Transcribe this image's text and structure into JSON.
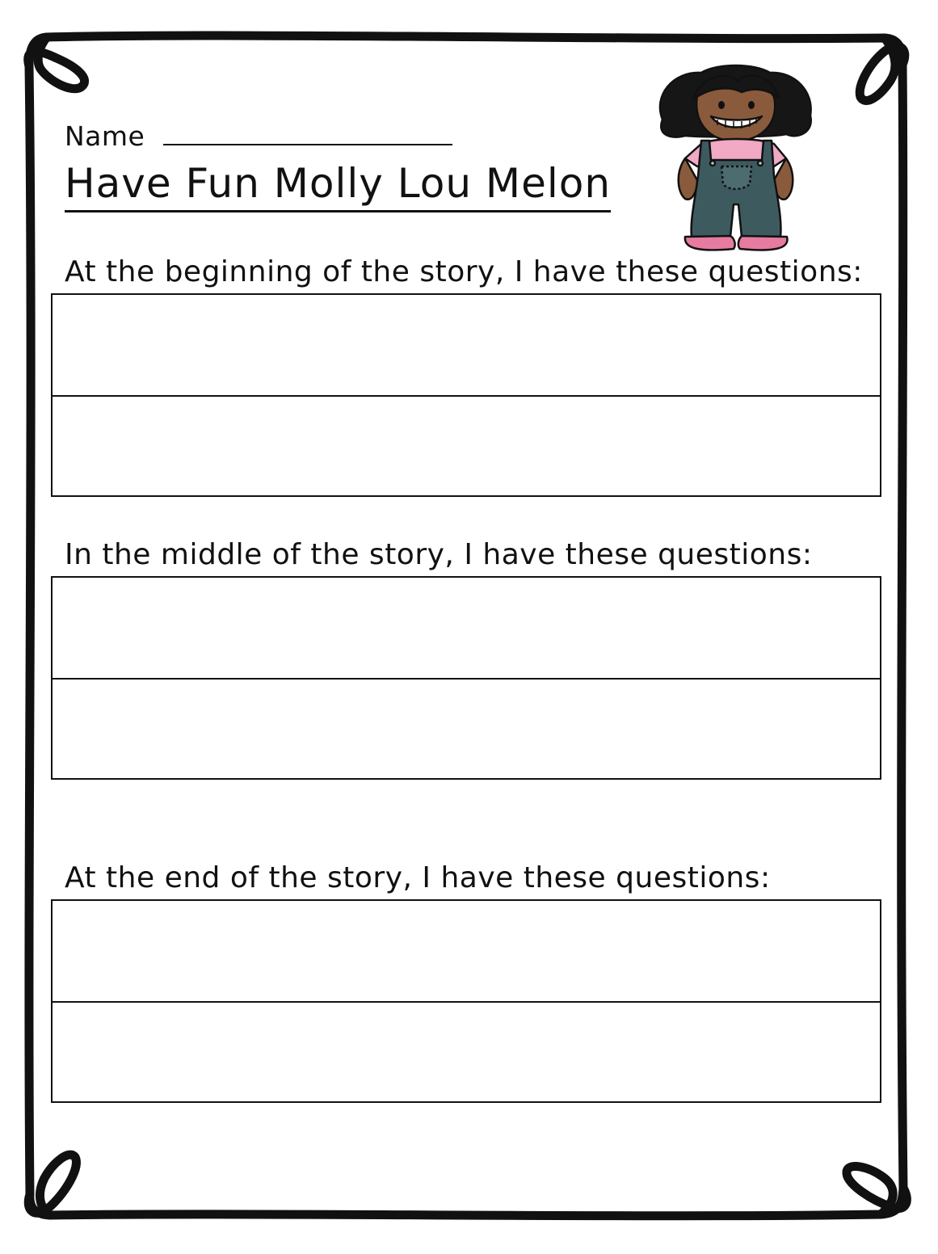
{
  "worksheet": {
    "name_label": "Name",
    "title": "Have Fun Molly Lou Melon",
    "sections": [
      {
        "prompt": "At the beginning of the story, I have these questions:"
      },
      {
        "prompt": "In the middle of the story, I have these questions:"
      },
      {
        "prompt": "At the end of the story, I have these questions:"
      }
    ]
  },
  "illustration": {
    "icon": "girl-in-overalls-clipart",
    "colors": {
      "skin": "#8a5a3c",
      "hair": "#161616",
      "overalls": "#3d5a5f",
      "shirt": "#f2a9c4",
      "shoes": "#e77aa1"
    }
  },
  "border": {
    "color": "#111111",
    "style": "hand-drawn frame with curled corner loops"
  }
}
